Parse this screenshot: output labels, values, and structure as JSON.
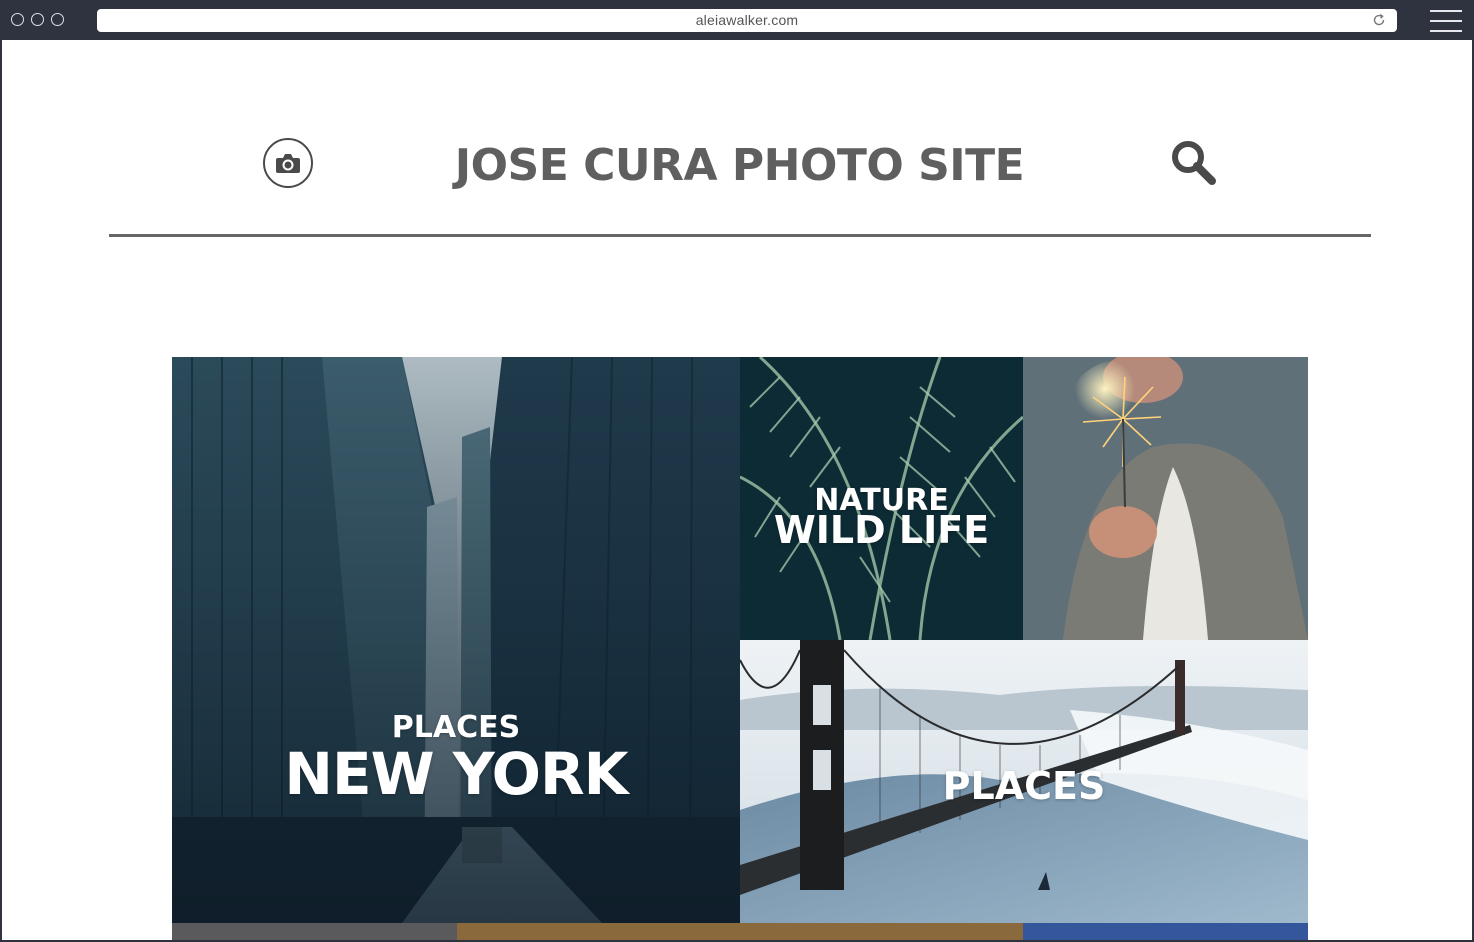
{
  "browser": {
    "url": "aleiawalker.com"
  },
  "header": {
    "title": "JOSE CURA PHOTO SITE",
    "left_icon": "camera-icon",
    "right_icon": "search-icon"
  },
  "gallery": {
    "tiles": [
      {
        "category": "PLACES",
        "title": "NEW YORK"
      },
      {
        "category": "NATURE",
        "title": "WILD LIFE"
      },
      {
        "category": "",
        "title": ""
      },
      {
        "category": "PLACES",
        "title": ""
      }
    ]
  },
  "colors": {
    "chrome": "#2f3340",
    "title": "#5f5f5f",
    "divider": "#666666",
    "caption": "#ffffff"
  }
}
